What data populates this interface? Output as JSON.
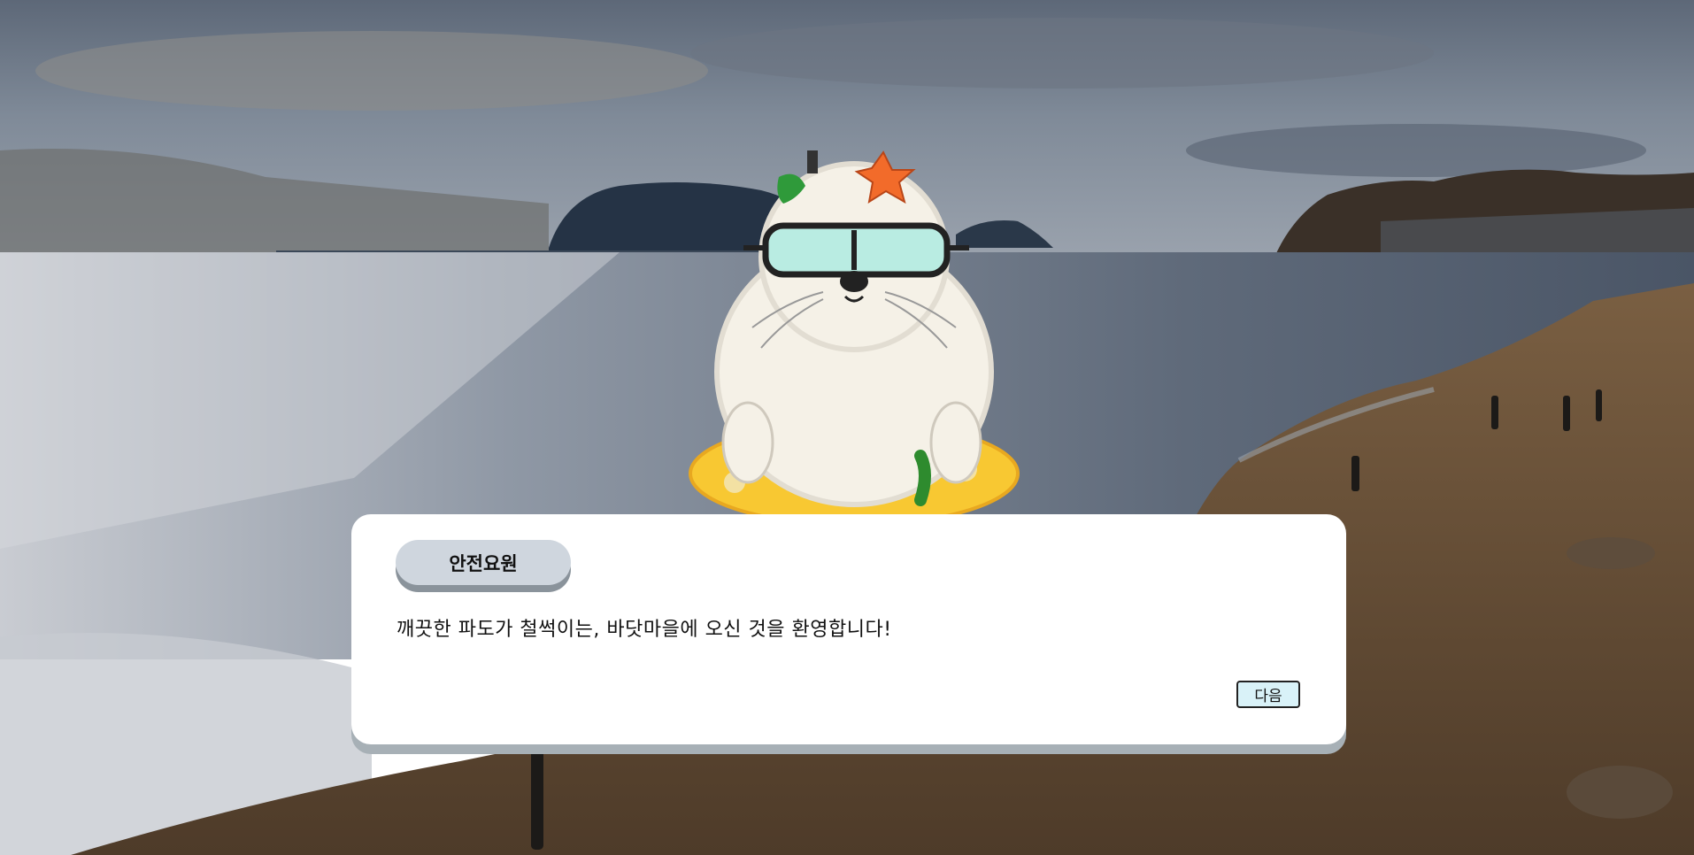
{
  "dialog": {
    "speaker": "안전요원",
    "line": "깨끗한 파도가 철썩이는, 바닷마을에 오신 것을 환영합니다!",
    "next_label": "다음"
  },
  "character": {
    "name": "seal-lifeguard"
  }
}
